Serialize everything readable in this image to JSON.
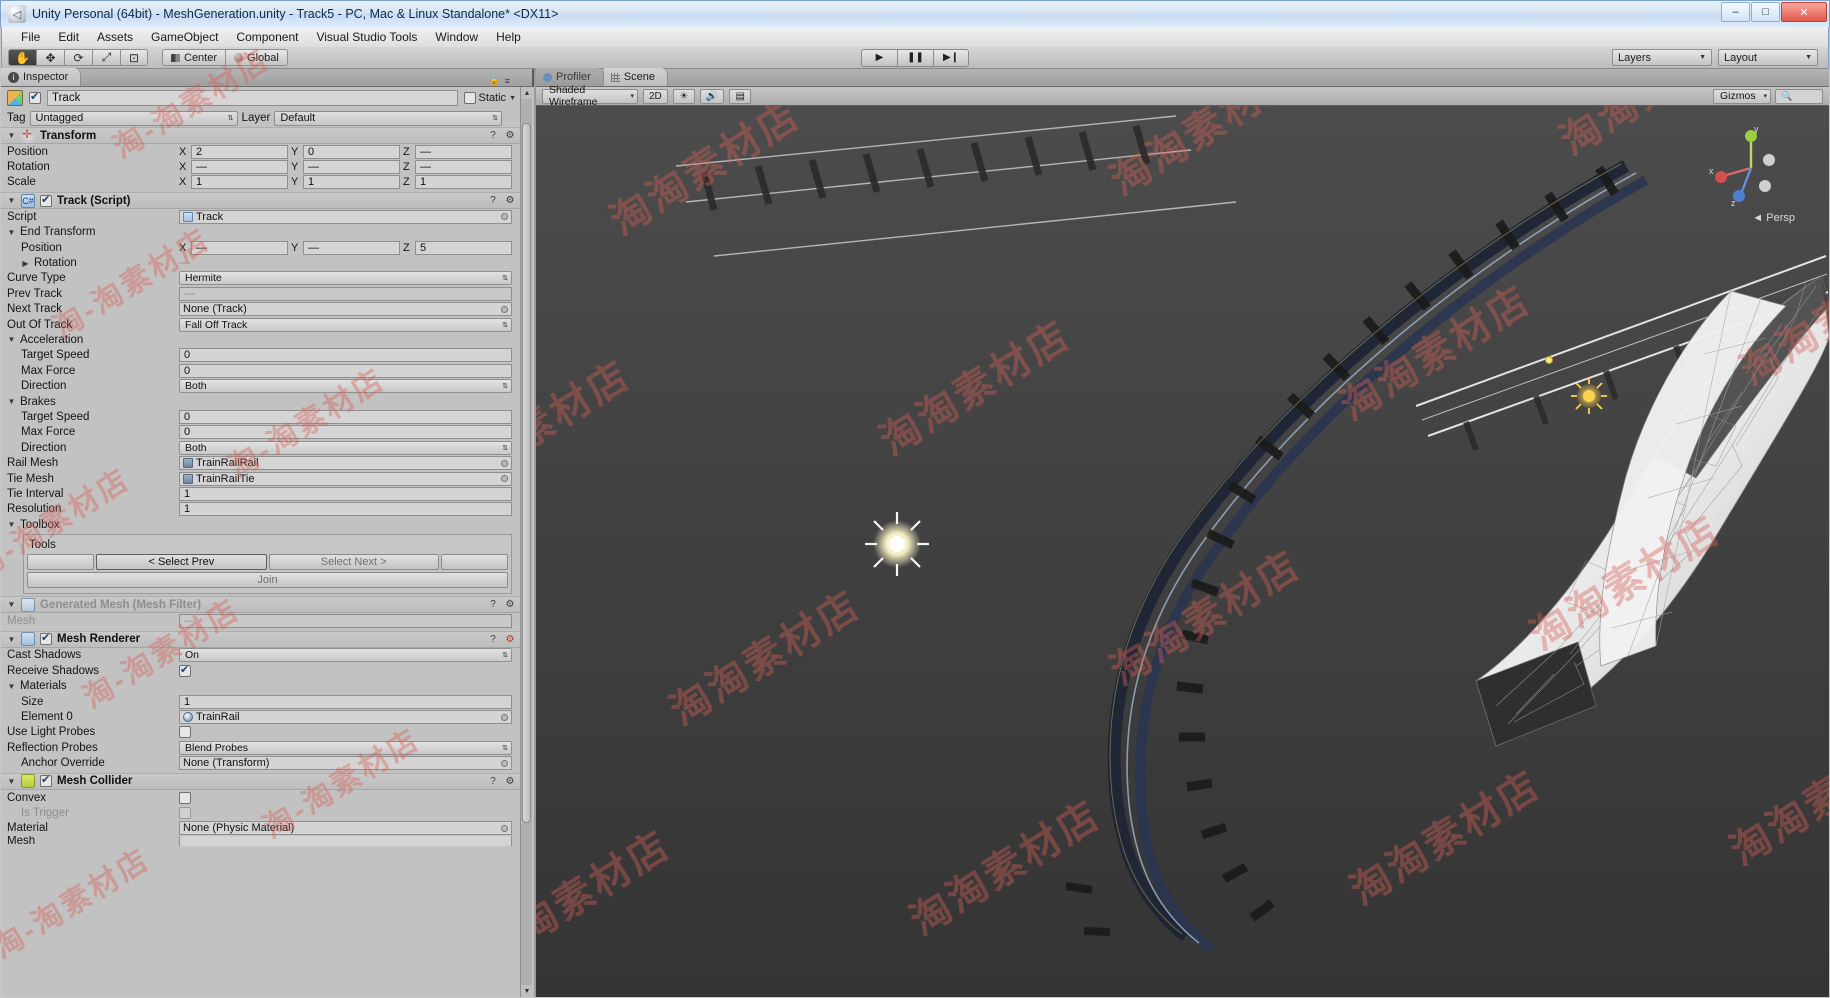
{
  "window": {
    "title": "Unity Personal (64bit) - MeshGeneration.unity - Track5 - PC, Mac & Linux Standalone* <DX11>",
    "app_icon": "unity-logo-icon",
    "minimize": "–",
    "maximize": "□",
    "close": "✕"
  },
  "menubar": {
    "items": [
      "File",
      "Edit",
      "Assets",
      "GameObject",
      "Component",
      "Visual Studio Tools",
      "Window",
      "Help"
    ]
  },
  "toolbar": {
    "tools": [
      {
        "name": "hand-tool",
        "glyph": "✋",
        "active": true
      },
      {
        "name": "move-tool",
        "glyph": "✥",
        "active": false
      },
      {
        "name": "rotate-tool",
        "glyph": "⟳",
        "active": false
      },
      {
        "name": "scale-tool",
        "glyph": "⤢",
        "active": false
      },
      {
        "name": "rect-tool",
        "glyph": "⊡",
        "active": false
      }
    ],
    "pivot_mode": "Center",
    "pivot_rotation": "Global",
    "play": "▶",
    "pause": "❚❚",
    "step": "▶❙",
    "layers": "Layers",
    "layout": "Layout"
  },
  "inspector": {
    "tab": "Inspector",
    "tab_icon": "info-icon",
    "object_name": "Track",
    "object_enabled": true,
    "static_label": "Static",
    "tag_label": "Tag",
    "tag_value": "Untagged",
    "layer_label": "Layer",
    "layer_value": "Default",
    "transform": {
      "title": "Transform",
      "rows": [
        {
          "label": "Position",
          "x": "2",
          "y": "0",
          "z": "—"
        },
        {
          "label": "Rotation",
          "x": "—",
          "y": "—",
          "z": "—"
        },
        {
          "label": "Scale",
          "x": "1",
          "y": "1",
          "z": "1"
        }
      ],
      "axes": [
        "X",
        "Y",
        "Z"
      ]
    },
    "track_script": {
      "title": "Track (Script)",
      "enabled": true,
      "script_label": "Script",
      "script_value": "Track",
      "end_transform_label": "End Transform",
      "end_position_label": "Position",
      "end_position": {
        "x": "—",
        "y": "—",
        "z": "5"
      },
      "end_rotation_label": "Rotation",
      "end_rotation_value": "—",
      "curve_type_label": "Curve Type",
      "curve_type_value": "Hermite",
      "prev_track_label": "Prev Track",
      "prev_track_value": "—",
      "next_track_label": "Next Track",
      "next_track_value": "None (Track)",
      "out_of_track_label": "Out Of Track",
      "out_of_track_value": "Fall Off Track",
      "acceleration_label": "Acceleration",
      "acceleration": {
        "target_speed_label": "Target Speed",
        "target_speed": "0",
        "max_force_label": "Max Force",
        "max_force": "0",
        "direction_label": "Direction",
        "direction": "Both"
      },
      "brakes_label": "Brakes",
      "brakes": {
        "target_speed_label": "Target Speed",
        "target_speed": "0",
        "max_force_label": "Max Force",
        "max_force": "0",
        "direction_label": "Direction",
        "direction": "Both"
      },
      "rail_mesh_label": "Rail Mesh",
      "rail_mesh_value": "TrainRailRail",
      "tie_mesh_label": "Tie Mesh",
      "tie_mesh_value": "TrainRailTie",
      "tie_interval_label": "Tie Interval",
      "tie_interval_value": "1",
      "resolution_label": "Resolution",
      "resolution_value": "1",
      "toolbox_label": "Toolbox",
      "tools_label": "Tools",
      "btn_blank_left": "",
      "btn_select_prev": "< Select Prev",
      "btn_select_next": "Select Next >",
      "btn_blank_right": "",
      "btn_join": "Join"
    },
    "mesh_filter": {
      "title": "Generated Mesh (Mesh Filter)",
      "mesh_label": "Mesh",
      "mesh_value": "—"
    },
    "mesh_renderer": {
      "title": "Mesh Renderer",
      "enabled": true,
      "cast_shadows_label": "Cast Shadows",
      "cast_shadows_value": "On",
      "receive_shadows_label": "Receive Shadows",
      "receive_shadows_value": true,
      "materials_label": "Materials",
      "size_label": "Size",
      "size_value": "1",
      "element0_label": "Element 0",
      "element0_value": "TrainRail",
      "use_light_probes_label": "Use Light Probes",
      "use_light_probes_value": false,
      "reflection_probes_label": "Reflection Probes",
      "reflection_probes_value": "Blend Probes",
      "anchor_override_label": "Anchor Override",
      "anchor_override_value": "None (Transform)"
    },
    "mesh_collider": {
      "title": "Mesh Collider",
      "enabled": true,
      "convex_label": "Convex",
      "convex_value": false,
      "is_trigger_label": "Is Trigger",
      "is_trigger_value": false,
      "material_label": "Material",
      "material_value": "None (Physic Material)",
      "mesh_label": "Mesh"
    }
  },
  "scene": {
    "tabs": [
      {
        "label": "Profiler",
        "icon": "profiler-icon",
        "active": false
      },
      {
        "label": "Scene",
        "icon": "scene-icon",
        "active": true
      }
    ],
    "draw_mode": "Shaded Wireframe",
    "toggle_2d": "2D",
    "light_icon": "sun-icon",
    "audio_icon": "speaker-icon",
    "fx_icon": "effects-icon",
    "gizmos_label": "Gizmos",
    "search_placeholder": "",
    "persp_label": "Persp",
    "axis_labels": {
      "x": "x",
      "y": "y",
      "z": "z"
    }
  },
  "watermarks": [
    "淘淘素材店",
    "淘-淘素材店"
  ],
  "colors": {
    "accent_blue": "#2a3d6e",
    "panel_bg": "#c2c2c2",
    "viewport_bg": "#3f3f3f",
    "watermark": "#d66055"
  }
}
